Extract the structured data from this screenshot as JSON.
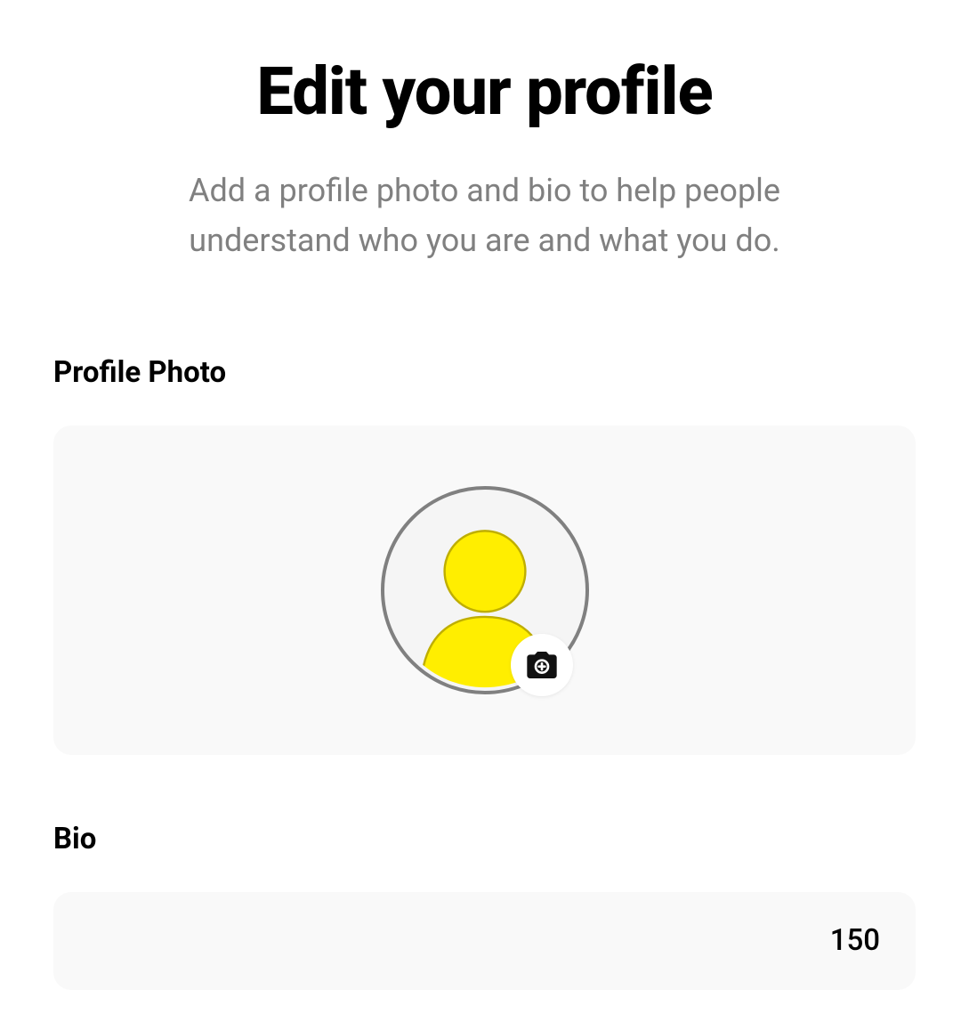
{
  "header": {
    "title": "Edit your profile",
    "subtitle": "Add a profile photo and bio to help people understand who you are and what you do."
  },
  "profilePhoto": {
    "label": "Profile Photo",
    "avatarColor": "#FFEE00",
    "avatarStroke": "#BFAE00"
  },
  "bio": {
    "label": "Bio",
    "value": "",
    "charLimit": "150"
  }
}
